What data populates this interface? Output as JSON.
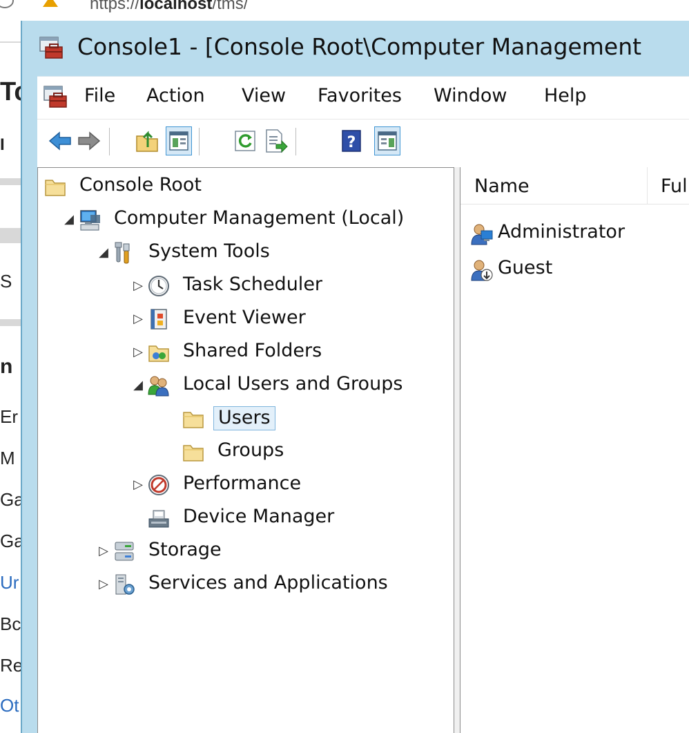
{
  "browser": {
    "url_scheme_host": "https://",
    "url_host": "localhost",
    "url_path": "/tms/",
    "bg_fragments": [
      "Tc",
      "I",
      "S",
      "n",
      "Er",
      "M",
      "Ga",
      "Ga",
      "Ur",
      "Bc",
      "Re",
      "Ot"
    ]
  },
  "window": {
    "title": "Console1 - [Console Root\\Computer Management"
  },
  "menu": {
    "items": [
      "File",
      "Action",
      "View",
      "Favorites",
      "Window",
      "Help"
    ]
  },
  "toolbar": {
    "buttons": [
      {
        "name": "back-button",
        "icon": "back-arrow-icon"
      },
      {
        "name": "forward-button",
        "icon": "forward-arrow-icon"
      },
      {
        "name": "up-one-level-button",
        "icon": "up-folder-icon"
      },
      {
        "name": "show-hide-console-tree-button",
        "icon": "console-tree-icon",
        "pressed": true
      },
      {
        "name": "refresh-button",
        "icon": "refresh-icon"
      },
      {
        "name": "export-list-button",
        "icon": "export-list-icon"
      },
      {
        "name": "help-button",
        "icon": "help-icon"
      },
      {
        "name": "show-hide-action-pane-button",
        "icon": "action-pane-icon",
        "pressed": true
      }
    ]
  },
  "tree": {
    "items": [
      {
        "label": "Console Root",
        "icon": "folder-icon",
        "expander": "",
        "level": 0
      },
      {
        "label": "Computer Management (Local)",
        "icon": "computer-management-icon",
        "expander": "expanded",
        "level": 1
      },
      {
        "label": "System Tools",
        "icon": "system-tools-icon",
        "expander": "expanded",
        "level": 2
      },
      {
        "label": "Task Scheduler",
        "icon": "clock-icon",
        "expander": "collapsed",
        "level": 3
      },
      {
        "label": "Event Viewer",
        "icon": "event-viewer-icon",
        "expander": "collapsed",
        "level": 3
      },
      {
        "label": "Shared Folders",
        "icon": "shared-folders-icon",
        "expander": "collapsed",
        "level": 3
      },
      {
        "label": "Local Users and Groups",
        "icon": "users-group-icon",
        "expander": "expanded",
        "level": 3
      },
      {
        "label": "Users",
        "icon": "folder-icon",
        "expander": "",
        "level": 4,
        "selected": true
      },
      {
        "label": "Groups",
        "icon": "folder-icon",
        "expander": "",
        "level": 4
      },
      {
        "label": "Performance",
        "icon": "performance-icon",
        "expander": "collapsed",
        "level": 3
      },
      {
        "label": "Device Manager",
        "icon": "device-manager-icon",
        "expander": "",
        "level": 3
      },
      {
        "label": "Storage",
        "icon": "storage-icon",
        "expander": "collapsed",
        "level": 2
      },
      {
        "label": "Services and Applications",
        "icon": "services-icon",
        "expander": "collapsed",
        "level": 2
      }
    ]
  },
  "list": {
    "columns": [
      "Name",
      "Ful"
    ],
    "rows": [
      {
        "name": "Administrator",
        "icon": "user-icon"
      },
      {
        "name": "Guest",
        "icon": "user-disabled-icon"
      }
    ]
  },
  "colors": {
    "title_bar": "#b9dced",
    "selection_fill": "#e3f0fa",
    "selection_border": "#7eb4dc"
  }
}
